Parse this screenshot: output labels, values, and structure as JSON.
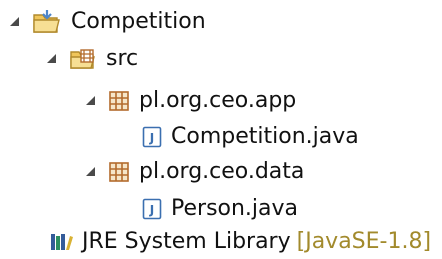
{
  "project_explorer": {
    "items": [
      {
        "label": "Competition",
        "icon": "project-folder-icon",
        "state": "expanded"
      },
      {
        "label": "src",
        "icon": "source-folder-icon",
        "state": "expanded"
      },
      {
        "label": "pl.org.ceo.app",
        "icon": "package-icon",
        "state": "expanded"
      },
      {
        "label": "Competition.java",
        "icon": "java-file-icon",
        "state": "collapsed"
      },
      {
        "label": "pl.org.ceo.data",
        "icon": "package-icon",
        "state": "expanded"
      },
      {
        "label": "Person.java",
        "icon": "java-file-icon",
        "state": "collapsed"
      },
      {
        "label": "JRE System Library",
        "decoration": "[JavaSE-1.8]",
        "icon": "library-icon",
        "state": "collapsed"
      }
    ]
  },
  "colors": {
    "text": "#111111",
    "decoration": "#a28a2c",
    "folder": "#f0c65b",
    "folder_accent": "#4e86c8",
    "package": "#b36b2d",
    "java_file_border": "#3b6fb0",
    "library_bars": "#355c9a",
    "library_accent": "#d9b233"
  }
}
